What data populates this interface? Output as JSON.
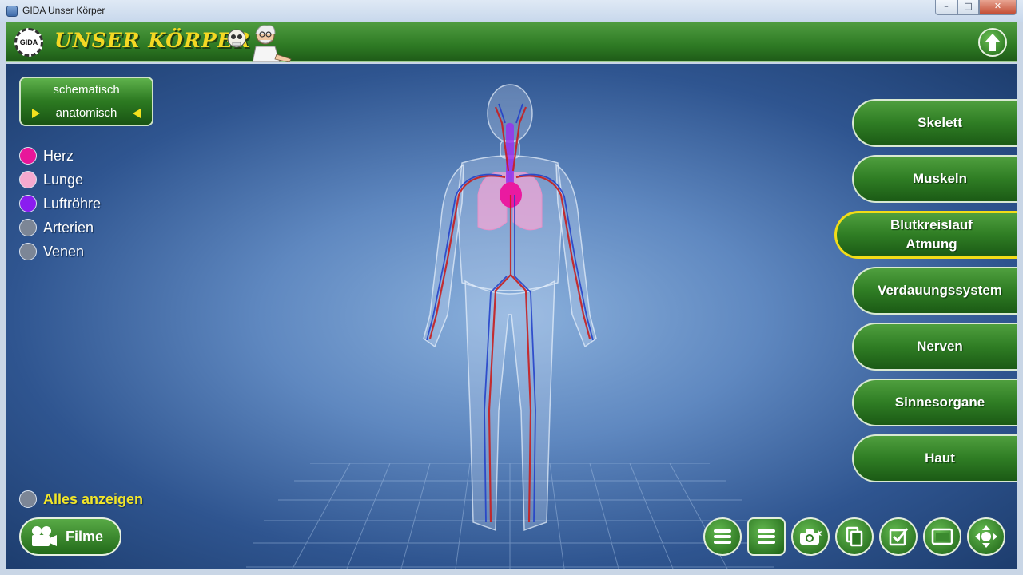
{
  "window": {
    "title": "GIDA Unser Körper",
    "controls": {
      "minimize": "–",
      "maximize": "□",
      "close": "✕"
    }
  },
  "header": {
    "logo_text": "GIDA",
    "app_title": "UNSER KÖRPER"
  },
  "view_mode": {
    "options": [
      {
        "label": "schematisch",
        "selected": false
      },
      {
        "label": "anatomisch",
        "selected": true
      }
    ]
  },
  "legend": {
    "items": [
      {
        "label": "Herz",
        "color": "#e8169a",
        "active": true
      },
      {
        "label": "Lunge",
        "color": "#f5a9cf",
        "active": true
      },
      {
        "label": "Luftröhre",
        "color": "#8a1cf0",
        "active": true
      },
      {
        "label": "Arterien",
        "color": "#7c8696",
        "active": false
      },
      {
        "label": "Venen",
        "color": "#7c8696",
        "active": false
      }
    ],
    "show_all": {
      "label": "Alles anzeigen",
      "color": "#7c8696"
    }
  },
  "film_button": {
    "label": "Filme"
  },
  "systems_menu": {
    "items": [
      {
        "label": "Skelett",
        "active": false
      },
      {
        "label": "Muskeln",
        "active": false
      },
      {
        "label": "Blutkreislauf\nAtmung",
        "active": true
      },
      {
        "label": "Verdauungssystem",
        "active": false
      },
      {
        "label": "Nerven",
        "active": false
      },
      {
        "label": "Sinnesorgane",
        "active": false
      },
      {
        "label": "Haut",
        "active": false
      }
    ]
  },
  "toolbar": {
    "icons": [
      "list-icon",
      "list-icon",
      "camera-icon",
      "copy-icon",
      "checklist-icon",
      "frame-icon",
      "navigation-icon"
    ]
  },
  "colors": {
    "accent_green": "#2e7a24",
    "highlight_yellow": "#f2dc18",
    "artery_red": "#c81e1e",
    "vein_blue": "#1e3cc8"
  }
}
